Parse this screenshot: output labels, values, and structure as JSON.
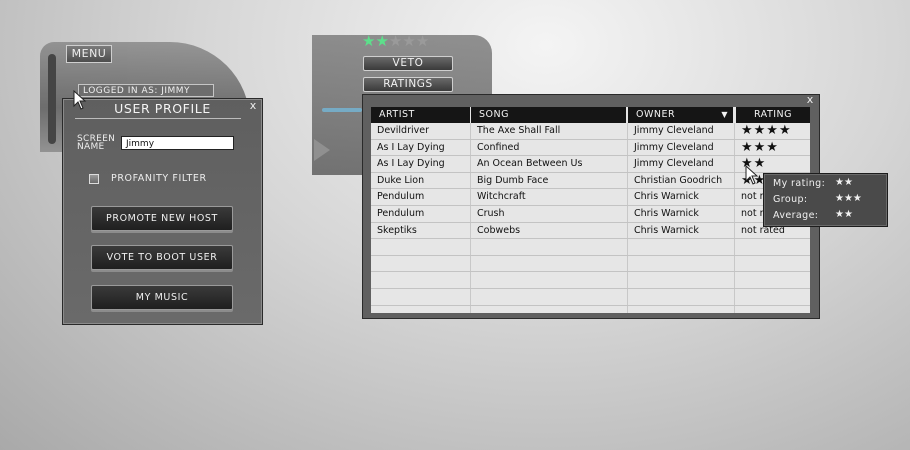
{
  "header": {
    "menu_label": "MENU",
    "logged_in_text": "LOGGED IN AS: JIMMY"
  },
  "user_profile": {
    "title": "USER PROFILE",
    "close_label": "x",
    "screen_name_label": "SCREEN NAME",
    "screen_name_value": "Jimmy",
    "profanity_filter_label": "PROFANITY FILTER",
    "profanity_filter_checked": false,
    "buttons": [
      "PROMOTE NEW HOST",
      "VOTE TO BOOT USER",
      "MY MUSIC"
    ]
  },
  "current_song": {
    "rating_filled": 2,
    "rating_max": 5,
    "accent_color": "#5ddf8b",
    "veto_label": "VETO",
    "ratings_label": "RATINGS"
  },
  "playlist": {
    "close_label": "x",
    "columns": [
      "ARTIST",
      "SONG",
      "OWNER",
      "RATING"
    ],
    "sort_indicator": "▼",
    "rows": [
      {
        "artist": "Devildriver",
        "song": "The Axe Shall Fall",
        "owner": "Jimmy Cleveland",
        "rating": "★★★★"
      },
      {
        "artist": "As I Lay Dying",
        "song": "Confined",
        "owner": "Jimmy Cleveland",
        "rating": "★★★"
      },
      {
        "artist": "As I Lay Dying",
        "song": "An Ocean Between Us",
        "owner": "Jimmy Cleveland",
        "rating": "★★"
      },
      {
        "artist": "Duke Lion",
        "song": "Big Dumb Face",
        "owner": "Christian Goodrich",
        "rating": "★★"
      },
      {
        "artist": "Pendulum",
        "song": "Witchcraft",
        "owner": "Chris Warnick",
        "rating": "not rated"
      },
      {
        "artist": "Pendulum",
        "song": "Crush",
        "owner": "Chris Warnick",
        "rating": "not rated"
      },
      {
        "artist": "Skeptiks",
        "song": "Cobwebs",
        "owner": "Chris Warnick",
        "rating": "not rated"
      }
    ]
  },
  "rating_tooltip": {
    "my_rating_label": "My rating:",
    "my_rating_value": "★★",
    "group_label": "Group:",
    "group_value": "★★★",
    "average_label": "Average:",
    "average_value": "★★"
  }
}
